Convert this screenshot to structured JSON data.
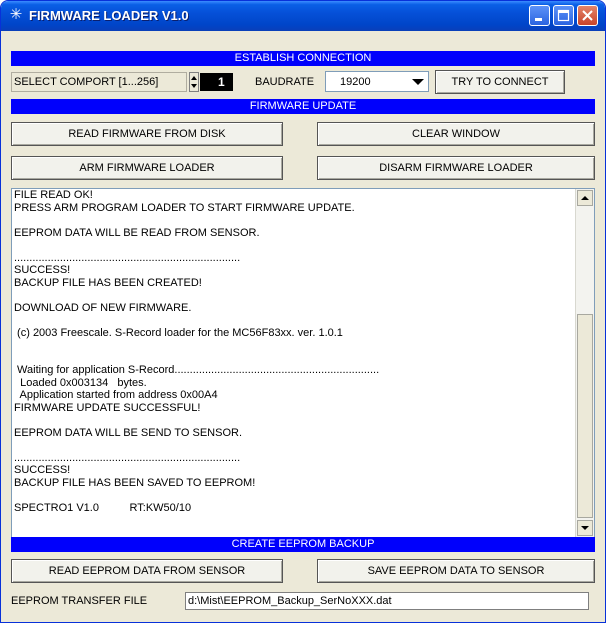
{
  "window": {
    "title": "FIRMWARE LOADER V1.0",
    "icon": "asterisk-icon",
    "accent": "#0000fc"
  },
  "connection": {
    "header": "ESTABLISH CONNECTION",
    "comport_label": "SELECT COMPORT [1...256]",
    "comport_value": "1",
    "baudrate_label": "BAUDRATE",
    "baudrate_value": "19200",
    "connect_button": "TRY TO CONNECT"
  },
  "firmware": {
    "header": "FIRMWARE UPDATE",
    "read_button": "READ FIRMWARE FROM DISK",
    "clear_button": "CLEAR WINDOW",
    "arm_button": "ARM FIRMWARE LOADER",
    "disarm_button": "DISARM FIRMWARE LOADER"
  },
  "log": {
    "lines": [
      "FILE READ OK!",
      "PRESS ARM PROGRAM LOADER TO START FIRMWARE UPDATE.",
      "",
      "EEPROM DATA WILL BE READ FROM SENSOR.",
      "",
      "..........................................................................",
      "SUCCESS!",
      "BACKUP FILE HAS BEEN CREATED!",
      "",
      "DOWNLOAD OF NEW FIRMWARE.",
      "",
      " (c) 2003 Freescale. S-Record loader for the MC56F83xx. ver. 1.0.1",
      "",
      "",
      " Waiting for application S-Record...................................................................",
      "  Loaded 0x003134   bytes.",
      "  Application started from address 0x00A4",
      "FIRMWARE UPDATE SUCCESSFUL!",
      "",
      "EEPROM DATA WILL BE SEND TO SENSOR.",
      "",
      "..........................................................................",
      "SUCCESS!",
      "BACKUP FILE HAS BEEN SAVED TO EEPROM!",
      "",
      "SPECTRO1 V1.0          RT:KW50/10"
    ]
  },
  "backup": {
    "header": "CREATE EEPROM BACKUP",
    "read_button": "READ EEPROM DATA FROM SENSOR",
    "save_button": "SAVE EEPROM DATA TO SENSOR",
    "file_label": "EEPROM TRANSFER FILE",
    "file_value": "d:\\Mist\\EEPROM_Backup_SerNoXXX.dat"
  }
}
